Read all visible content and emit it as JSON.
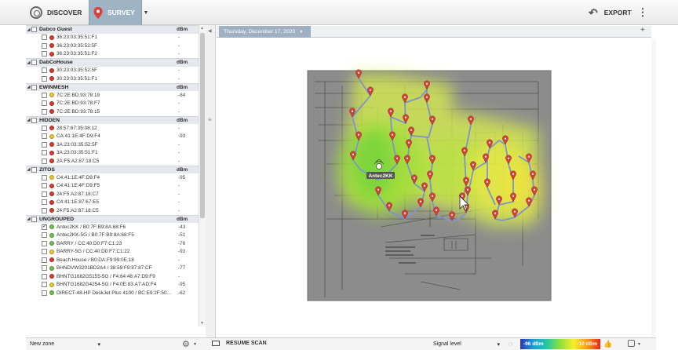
{
  "toolbar": {
    "discover_label": "DISCOVER",
    "survey_label": "SURVEY",
    "export_label": "EXPORT"
  },
  "sidebar": {
    "groups": [
      {
        "name": "Dabco Guest",
        "unit": "dBm",
        "items": [
          {
            "label": "36:23:03:35:51:F1",
            "value": "-",
            "color": "#d63a2a"
          },
          {
            "label": "36:23:03:35:52:5F",
            "value": "-",
            "color": "#d63a2a"
          },
          {
            "label": "36:23:03:35:51:F2",
            "value": "-",
            "color": "#d63a2a"
          }
        ]
      },
      {
        "name": "DabCoHouse",
        "unit": "dBm",
        "items": [
          {
            "label": "30:23:03:35:52:5F",
            "value": "-",
            "color": "#d63a2a"
          },
          {
            "label": "30:23:03:35:51:F1",
            "value": "-",
            "color": "#d63a2a"
          }
        ]
      },
      {
        "name": "EWINMESH",
        "unit": "dBm",
        "items": [
          {
            "label": "7C:2E:BD:93:78:19",
            "value": "-84",
            "color": "#e4c72a"
          },
          {
            "label": "7C:2E:BD:93:78:F7",
            "value": "-",
            "color": "#d63a2a"
          },
          {
            "label": "7C:2E:BD:93:78:15",
            "value": "-",
            "color": "#d63a2a"
          }
        ]
      },
      {
        "name": "HIDDEN",
        "unit": "dBm",
        "items": [
          {
            "label": "28:57:67:35:08:12",
            "value": "-",
            "color": "#d63a2a"
          },
          {
            "label": "CA:41:1E:4F:D9:F4",
            "value": "-93",
            "color": "#e4c72a"
          },
          {
            "label": "3A:23:03:35:52:5F",
            "value": "-",
            "color": "#d63a2a"
          },
          {
            "label": "3A:23:03:35:51:F1",
            "value": "-",
            "color": "#d63a2a"
          },
          {
            "label": "2A:F5:A2:87:18:C5",
            "value": "-",
            "color": "#d63a2a"
          }
        ]
      },
      {
        "name": "ZITOS",
        "unit": "dBm",
        "items": [
          {
            "label": "C4:41:1E:4F:D9:F4",
            "value": "-95",
            "color": "#e4c72a"
          },
          {
            "label": "C4:41:1E:4F:D9:F5",
            "value": "-",
            "color": "#d63a2a"
          },
          {
            "label": "24:F5:A2:87:18:C7",
            "value": "-",
            "color": "#d63a2a"
          },
          {
            "label": "C4:41:1E:87:67:E5",
            "value": "-",
            "color": "#d63a2a"
          },
          {
            "label": "24:F5:A2:87:18:C5",
            "value": "-",
            "color": "#d63a2a"
          }
        ]
      },
      {
        "name": "UNGROUPED",
        "unit": "dBm",
        "items": [
          {
            "label": "Antec2KK / B0:7F:B9:8A:68:F6",
            "value": "-43",
            "color": "#6fbf4a",
            "checked": true
          },
          {
            "label": "Antec2KK-5G / B0:7F:B9:8A:68:F5",
            "value": "-51",
            "color": "#6fbf4a"
          },
          {
            "label": "BARRY / CC:40:D0:F7:C1:23",
            "value": "-76",
            "color": "#6fbf4a"
          },
          {
            "label": "BARRY-5G / CC:40:D0:F7:C1:22",
            "value": "-93",
            "color": "#e4c72a"
          },
          {
            "label": "Beach House / B0:DA:F9:99:0E:18",
            "value": "-",
            "color": "#d63a2a"
          },
          {
            "label": "BHNDVW3201BD2A4 / 38:59:F9:87:87:CF",
            "value": "-77",
            "color": "#6fbf4a"
          },
          {
            "label": "BHNTG1682G5155-5G / F4:64:48:A7:D9:F9",
            "value": "-",
            "color": "#d63a2a"
          },
          {
            "label": "BHNTG1682G4254-5G / F4:0E:83:A7:AD:F4",
            "value": "-95",
            "color": "#e4c72a"
          },
          {
            "label": "DIRECT-48-HP DeskJet Plus 4100 / BC:E9:2F:50...",
            "value": "-62",
            "color": "#6fbf4a"
          }
        ]
      }
    ],
    "zone_select": "New zone"
  },
  "main": {
    "date_tab": "Thursday, December 17, 2020",
    "ap_label": "Antec2KK",
    "resume_label": "RESUME SCAN",
    "signal_select": "Signal level",
    "legend_min": "-96 dBm",
    "legend_max": "-10 dBm"
  },
  "colors": {
    "accent": "#9eb3c4",
    "pin": "#d6413a",
    "path": "#8096c8"
  },
  "icons": [
    "compass-icon",
    "map-pin-icon",
    "back-arrow-icon",
    "more-vertical-icon",
    "gear-icon",
    "stop-icon",
    "legend-toggle-icon",
    "thumbs-up-icon",
    "grid-icon"
  ]
}
